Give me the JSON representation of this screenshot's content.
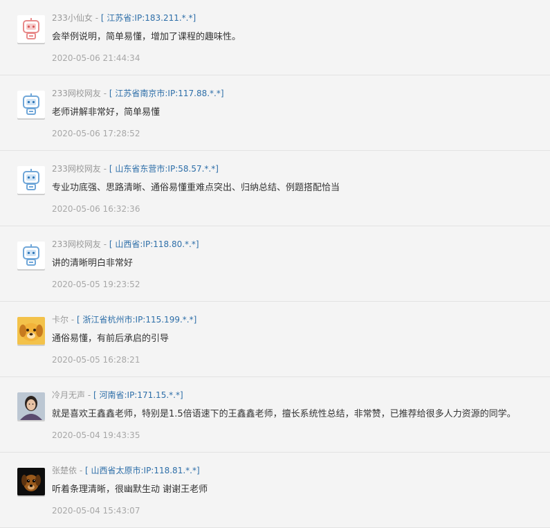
{
  "comments": [
    {
      "username": "233小仙女",
      "location": "[ 江苏省:IP:183.211.*.*]",
      "content": "会举例说明，简单易懂，增加了课程的趣味性。",
      "time": "2020-05-06 21:44:34",
      "avatar": "pink-robot-icon"
    },
    {
      "username": "233网校网友",
      "location": "[ 江苏省南京市:IP:117.88.*.*]",
      "content": "老师讲解非常好，简单易懂",
      "time": "2020-05-06 17:28:52",
      "avatar": "blue-robot-icon"
    },
    {
      "username": "233网校网友",
      "location": "[ 山东省东营市:IP:58.57.*.*]",
      "content": "专业功底强、思路清晰、通俗易懂重难点突出、归纳总结、例题搭配恰当",
      "time": "2020-05-06 16:32:36",
      "avatar": "blue-robot-icon"
    },
    {
      "username": "233网校网友",
      "location": "[ 山西省:IP:118.80.*.*]",
      "content": "讲的清晰明白非常好",
      "time": "2020-05-05 19:23:52",
      "avatar": "blue-robot-icon"
    },
    {
      "username": "卡尔",
      "location": "[ 浙江省杭州市:IP:115.199.*.*]",
      "content": "通俗易懂，有前后承启的引导",
      "time": "2020-05-05 16:28:21",
      "avatar": "dog-avatar"
    },
    {
      "username": "冷月无声",
      "location": "[ 河南省:IP:171.15.*.*]",
      "content": "就是喜欢王鑫鑫老师，特别是1.5倍语速下的王鑫鑫老师，擅长系统性总结，非常赞，已推荐给很多人力资源的同学。",
      "time": "2020-05-04 19:43:35",
      "avatar": "person-photo-avatar"
    },
    {
      "username": "张楚依",
      "location": "[ 山西省太原市:IP:118.81.*.*]",
      "content": "听着条理清晰，很幽默生动 谢谢王老师",
      "time": "2020-05-04 15:43:07",
      "avatar": "dog-photo-avatar"
    }
  ],
  "separator": " - ",
  "colors": {
    "username": "#9a9a9a",
    "location": "#2d6ea8",
    "content": "#333333",
    "time": "#a7a7a7",
    "background": "#f4f4f4"
  }
}
